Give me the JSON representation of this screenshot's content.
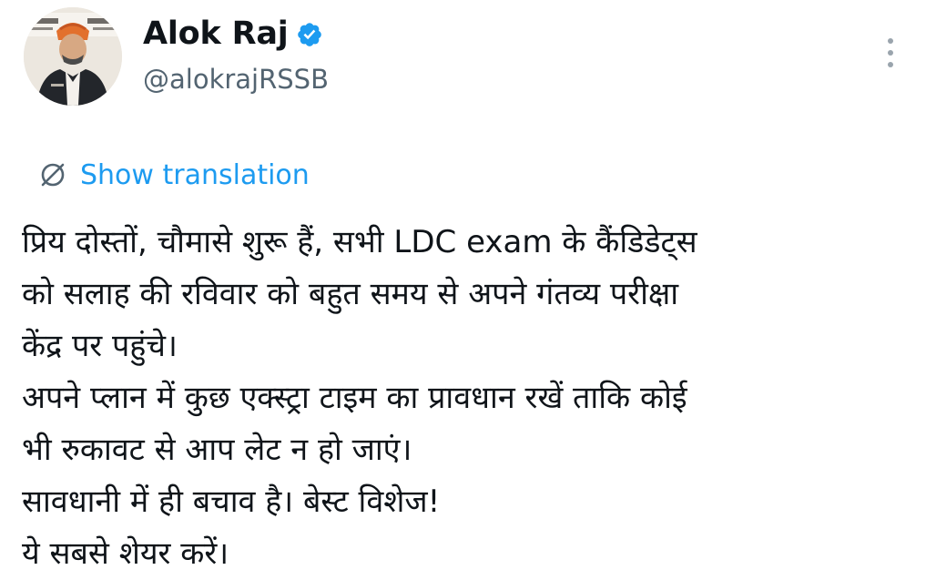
{
  "author": {
    "display_name": "Alok Raj",
    "handle": "@alokrajRSSB",
    "verified": true,
    "avatar_icon": "profile-photo"
  },
  "actions": {
    "more_icon": "vertical-ellipsis-icon"
  },
  "translation": {
    "icon": "globe-slash-icon",
    "label": "Show translation"
  },
  "tweet": {
    "lines": [
      "प्रिय दोस्तों, चौमासे शुरू हैं, सभी LDC exam के कैंडिडेट्स",
      "को सलाह की रविवार को बहुत समय से अपने गंतव्य परीक्षा",
      "केंद्र पर पहुंचे।",
      "अपने प्लान में कुछ एक्स्ट्रा टाइम का प्रावधान रखें ताकि कोई",
      "भी रुकावट से आप लेट न हो जाएं।",
      "सावधानी में ही बचाव है। बेस्ट विशेज!",
      "ये सबसे शेयर करें।"
    ]
  },
  "colors": {
    "accent": "#1d9bf0",
    "text_primary": "#0f1419",
    "text_secondary": "#536471"
  }
}
